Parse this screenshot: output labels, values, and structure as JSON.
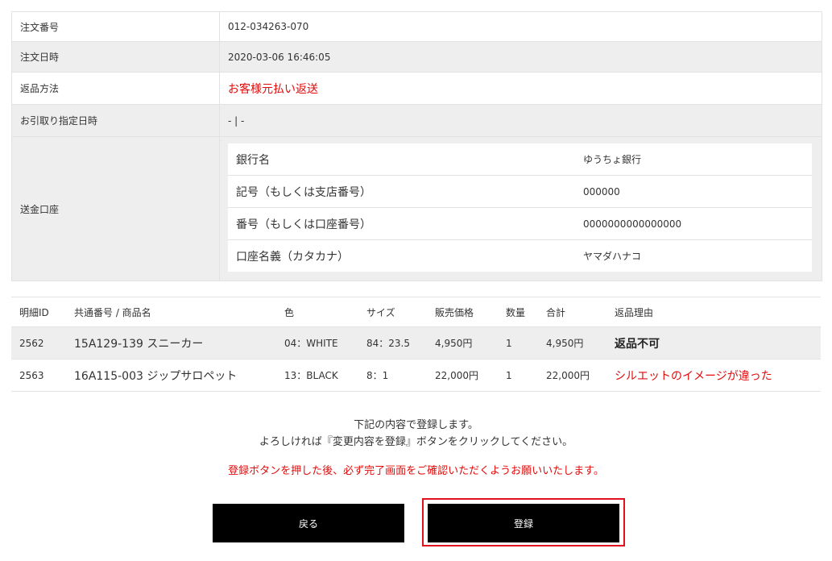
{
  "order": {
    "rows": [
      {
        "label": "注文番号",
        "value": "012-034263-070"
      },
      {
        "label": "注文日時",
        "value": "2020-03-06 16:46:05"
      },
      {
        "label": "返品方法",
        "value": "お客様元払い返送"
      },
      {
        "label": "お引取り指定日時",
        "value": "- | -"
      }
    ],
    "account_label": "送金口座",
    "bank": [
      {
        "label": "銀行名",
        "value": "ゆうちょ銀行"
      },
      {
        "label": "記号（もしくは支店番号）",
        "value": "000000"
      },
      {
        "label": "番号（もしくは口座番号）",
        "value": "0000000000000000"
      },
      {
        "label": "口座名義（カタカナ）",
        "value": "ヤマダハナコ"
      }
    ]
  },
  "items": {
    "headers": [
      "明細ID",
      "共通番号 / 商品名",
      "色",
      "サイズ",
      "販売価格",
      "数量",
      "合計",
      "返品理由"
    ],
    "rows": [
      {
        "id": "2562",
        "name": "15A129-139 スニーカー",
        "color": "04：WHITE",
        "size": "84：23.5",
        "price": "4,950円",
        "qty": "1",
        "total": "4,950円",
        "reason": "返品不可"
      },
      {
        "id": "2563",
        "name": "16A115-003 ジップサロペット",
        "color": "13：BLACK",
        "size": "8：1",
        "price": "22,000円",
        "qty": "1",
        "total": "22,000円",
        "reason": "シルエットのイメージが違った"
      }
    ]
  },
  "confirm": {
    "line1": "下記の内容で登録します。",
    "line2": "よろしければ『変更内容を登録』ボタンをクリックしてください。",
    "warning": "登録ボタンを押した後、必ず完了画面をご確認いただくようお願いいたします。"
  },
  "buttons": {
    "back": "戻る",
    "register": "登録"
  },
  "colors": {
    "accent_red": "#e30a0a",
    "button_bg": "#000000",
    "highlight_border": "#e0121d"
  }
}
